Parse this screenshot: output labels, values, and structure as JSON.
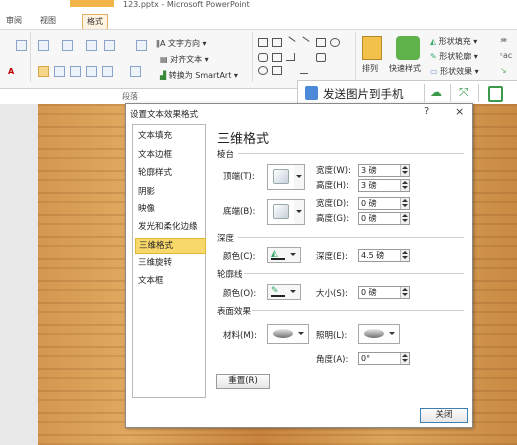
{
  "app": {
    "window_title": "123.pptx - Microsoft PowerPoint"
  },
  "ribbon": {
    "tabs": [
      "审阅",
      "视图",
      "格式"
    ],
    "active_tab": "格式",
    "paragraph_group_label": "段落",
    "text_direction_label": "文字方向",
    "align_text_label": "对齐文本",
    "convert_smartart_label": "转换为 SmartArt",
    "arrange_label": "排列",
    "quick_styles_label": "快速样式",
    "shape_fill_label": "形状填充",
    "shape_outline_label": "形状轮廓",
    "shape_effects_label": "形状效果"
  },
  "sendbar": {
    "send_label": "发送图片到手机"
  },
  "dialog": {
    "title": "设置文本效果格式",
    "help": "?",
    "close_x": "×",
    "categories": [
      "文本填充",
      "文本边框",
      "轮廓样式",
      "阴影",
      "映像",
      "发光和柔化边缘",
      "三维格式",
      "三维旋转",
      "文本框"
    ],
    "selected_category": "三维格式",
    "panel_title": "三维格式",
    "bevel": {
      "section": "棱台",
      "top_label": "顶端(T):",
      "bottom_label": "底端(B):",
      "top_width_label": "宽度(W):",
      "top_width_value": "3 磅",
      "top_height_label": "高度(H):",
      "top_height_value": "3 磅",
      "bottom_width_label": "宽度(D):",
      "bottom_width_value": "0 磅",
      "bottom_height_label": "高度(G):",
      "bottom_height_value": "0 磅"
    },
    "depth": {
      "section": "深度",
      "color_label": "颜色(C):",
      "depth_label": "深度(E):",
      "depth_value": "4.5 磅"
    },
    "contour": {
      "section": "轮廓线",
      "color_label": "颜色(O):",
      "size_label": "大小(S):",
      "size_value": "0 磅"
    },
    "surface": {
      "section": "表面效果",
      "material_label": "材料(M):",
      "lighting_label": "照明(L):",
      "angle_label": "角度(A):",
      "angle_value": "0°"
    },
    "reset_label": "重置(R)",
    "close_label": "关闭"
  }
}
